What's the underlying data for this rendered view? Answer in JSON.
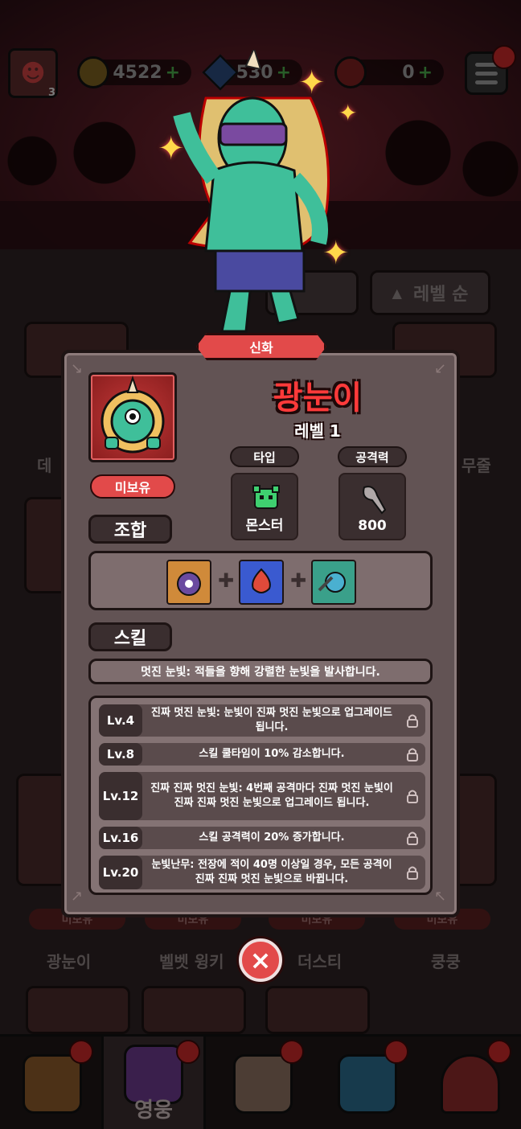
{
  "resources": {
    "gold": "4522",
    "gems": "530",
    "red": "0",
    "plus": "+"
  },
  "player": {
    "level": "3"
  },
  "sort": {
    "level_label": "레벨 순"
  },
  "background_cards": {
    "row1_names": [
      "데",
      "무줄"
    ],
    "row3_names": [
      "광눈이",
      "벨벳 윙키",
      "더스티",
      "쿵쿵"
    ],
    "owned_label": "미보유"
  },
  "modal": {
    "rarity": "신화",
    "name": "광눈이",
    "level": "레벨 1",
    "owned_status": "미보유",
    "stats": {
      "type_label": "타입",
      "type_value": "몬스터",
      "attack_label": "공격력",
      "attack_value": "800"
    },
    "combo_title": "조합",
    "skill_title": "스킬",
    "skill_description": "멋진 눈빛: 적들을 향해 강렬한 눈빛을 발사합니다.",
    "upgrades": [
      {
        "level": "Lv.4",
        "text": "진짜 멋진 눈빛: 눈빛이 진짜 멋진 눈빛으로 업그레이드 됩니다."
      },
      {
        "level": "Lv.8",
        "text": "스킬 쿨타임이 10% 감소합니다."
      },
      {
        "level": "Lv.12",
        "text": "진짜 진짜 멋진 눈빛: 4번째 공격마다 진짜 멋진 눈빛이 진짜 진짜 멋진 눈빛으로 업그레이드 됩니다."
      },
      {
        "level": "Lv.16",
        "text": "스킬 공격력이 20% 증가합니다."
      },
      {
        "level": "Lv.20",
        "text": "눈빛난무: 전장에 적이 40명 이상일 경우, 모든 공격이 진짜 진짜 멋진 눈빛으로 바뀝니다."
      }
    ],
    "close_icon": "×"
  },
  "bottom_nav": {
    "active_label": "영웅"
  },
  "colors": {
    "accent_red": "#e24a4a",
    "hero_name": "#ff3a3a",
    "panel": "#625354"
  }
}
